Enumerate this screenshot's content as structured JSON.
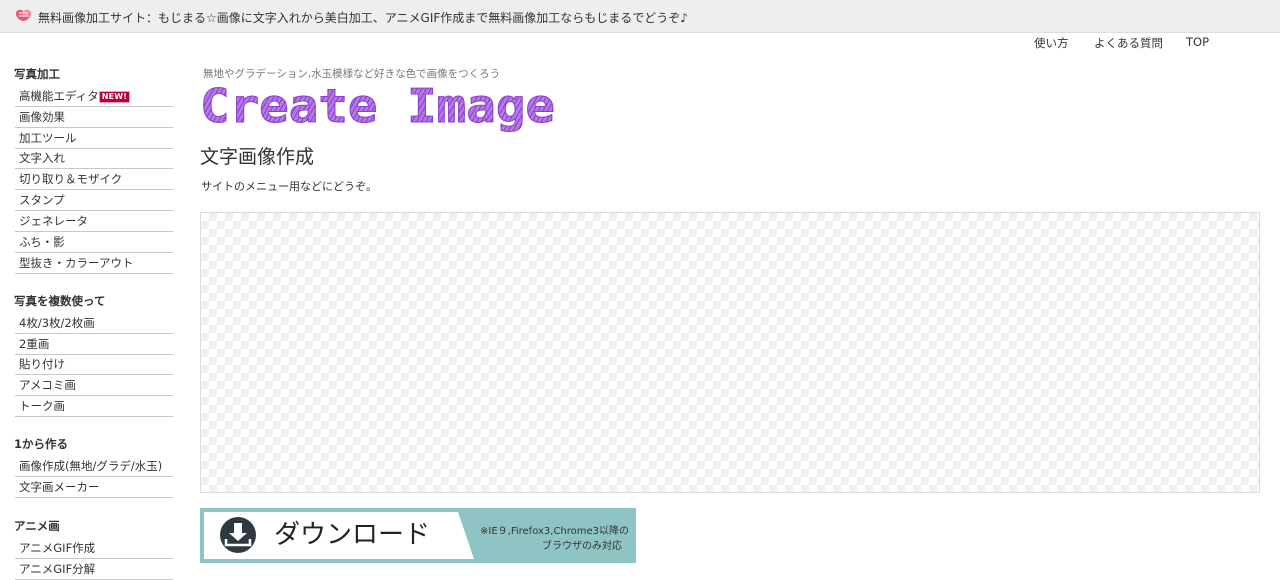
{
  "header": {
    "tagline": "無料画像加工サイト：もじまる☆画像に文字入れから美白加工、アニメGIF作成まで無料画像加工ならもじまるでどうぞ♪"
  },
  "top_nav": {
    "items": [
      {
        "label": "使い方"
      },
      {
        "label": "よくある質問"
      },
      {
        "label": "TOP"
      }
    ]
  },
  "sidebar": {
    "sections": [
      {
        "title": "写真加工",
        "items": [
          {
            "label": "高機能エディタ",
            "badge": "NEW!"
          },
          {
            "label": "画像効果"
          },
          {
            "label": "加工ツール"
          },
          {
            "label": "文字入れ"
          },
          {
            "label": "切り取り＆モザイク"
          },
          {
            "label": "スタンプ"
          },
          {
            "label": "ジェネレータ"
          },
          {
            "label": "ふち・影"
          },
          {
            "label": "型抜き・カラーアウト"
          }
        ]
      },
      {
        "title": "写真を複数使って",
        "items": [
          {
            "label": "4枚/3枚/2枚画"
          },
          {
            "label": "2重画"
          },
          {
            "label": "貼り付け"
          },
          {
            "label": "アメコミ画"
          },
          {
            "label": "トーク画"
          }
        ]
      },
      {
        "title": "1から作る",
        "items": [
          {
            "label": "画像作成(無地/グラデ/水玉)"
          },
          {
            "label": "文字画メーカー"
          }
        ]
      },
      {
        "title": "アニメ画",
        "items": [
          {
            "label": "アニメGIF作成"
          },
          {
            "label": "アニメGIF分解"
          }
        ]
      }
    ]
  },
  "main": {
    "subtitle": "無地やグラデーション,水玉模様など好きな色で画像をつくろう",
    "logo_text": "Create Image",
    "page_title": "文字画像作成",
    "description": "サイトのメニュー用などにどうぞ。",
    "download": {
      "label": "ダウンロード",
      "note_line1": "※IE９,Firefox3,Chrome3以降の",
      "note_line2": "ブラウザのみ対応"
    }
  },
  "colors": {
    "logo_purple": "#9b4fd6",
    "download_teal": "#8ec4c4",
    "badge": "#b3003c",
    "topbar_bg": "#eeeeee"
  }
}
